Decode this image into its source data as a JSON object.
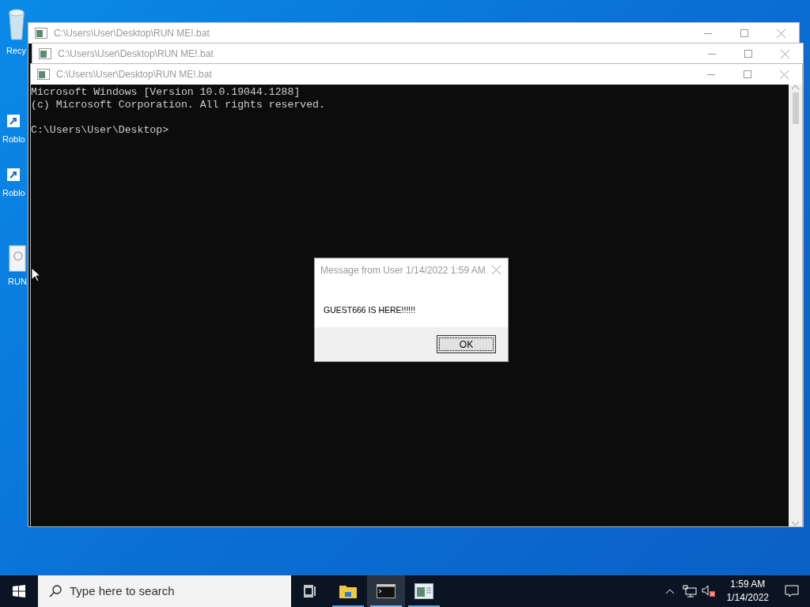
{
  "desktop_icons": [
    {
      "label": "Recy",
      "kind": "bin"
    },
    {
      "label": "Roblo",
      "kind": "shortcut"
    },
    {
      "label": "Roblo",
      "kind": "shortcut"
    },
    {
      "label": "RUN",
      "kind": "file"
    }
  ],
  "windows": [
    {
      "title": "C:\\Users\\User\\Desktop\\RUN ME!.bat"
    },
    {
      "title": "C:\\Users\\User\\Desktop\\RUN ME!.bat"
    },
    {
      "title": "C:\\Users\\User\\Desktop\\RUN ME!.bat"
    }
  ],
  "console": {
    "header_lines": [
      "Microsoft Windows [Version 10.0.19044.1288]",
      "(c) Microsoft Corporation. All rights reserved."
    ],
    "prompt": "C:\\Users\\User\\Desktop>"
  },
  "dialog": {
    "title": "Message from User 1/14/2022 1:59 AM",
    "message": "GUEST666 IS HERE!!!!!!",
    "button": "OK"
  },
  "taskbar": {
    "search_placeholder": "Type here to search",
    "apps": [
      {
        "kind": "task-view",
        "selected": false,
        "open": false
      },
      {
        "kind": "explorer",
        "selected": false,
        "open": true
      },
      {
        "kind": "console",
        "selected": true,
        "open": true
      },
      {
        "kind": "window",
        "selected": false,
        "open": true
      }
    ],
    "volume_muted": true,
    "time": "1:59 AM",
    "date": "1/14/2022"
  }
}
